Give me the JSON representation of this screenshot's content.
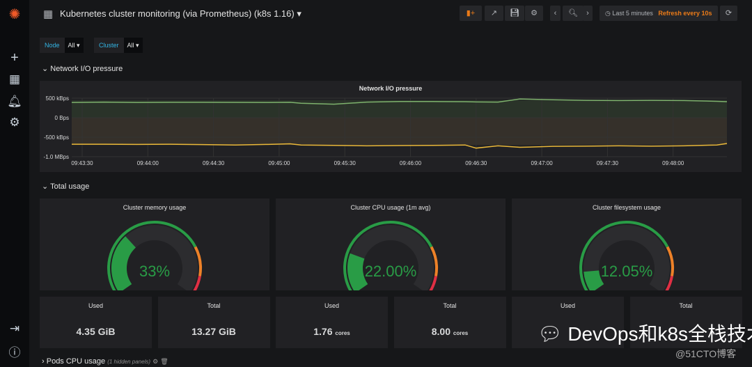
{
  "header": {
    "title": "Kubernetes cluster monitoring (via Prometheus) (k8s 1.16)",
    "time_range": "Last 5 minutes",
    "refresh": "Refresh every 10s"
  },
  "variables": [
    {
      "label": "Node",
      "value": "All"
    },
    {
      "label": "Cluster",
      "value": "All"
    }
  ],
  "rows": {
    "network": "Network I/O pressure",
    "total": "Total usage",
    "pods": "Pods CPU usage",
    "pods_hidden": "(1 hidden panels)"
  },
  "colors": {
    "accent": "#33b5e5",
    "refresh": "#eb7b18",
    "green": "#37872d",
    "ok": "#299c46",
    "warn": "#ed8128",
    "crit": "#e02f44",
    "in": "#7eb26d",
    "out": "#eab839"
  },
  "chart_data": {
    "type": "line",
    "title": "Network I/O pressure",
    "yticks": [
      "500 kBps",
      "0 Bps",
      "-500 kBps",
      "-1.0 MBps"
    ],
    "ylim": [
      -1000,
      500
    ],
    "yunit": "kBps",
    "xticks": [
      "09:43:30",
      "09:44:00",
      "09:44:30",
      "09:45:00",
      "09:45:30",
      "09:46:00",
      "09:46:30",
      "09:47:00",
      "09:47:30",
      "09:48:00"
    ],
    "x_seconds_from_first_tick": [
      -5,
      10,
      25,
      40,
      55,
      70,
      85,
      95,
      100,
      115,
      130,
      145,
      160,
      175,
      180,
      190,
      200,
      215,
      230,
      245,
      260,
      275,
      290,
      296
    ],
    "series": [
      {
        "values": [
          390,
          400,
          390,
          395,
          395,
          392,
          390,
          395,
          370,
          345,
          400,
          415,
          415,
          410,
          405,
          400,
          480,
          460,
          445,
          440,
          445,
          440,
          420,
          410
        ],
        "color": "#7eb26d"
      },
      {
        "values": [
          -680,
          -680,
          -685,
          -680,
          -690,
          -700,
          -685,
          -670,
          -700,
          -710,
          -720,
          -715,
          -710,
          -700,
          -780,
          -720,
          -760,
          -735,
          -730,
          -720,
          -730,
          -720,
          -700,
          -660
        ],
        "color": "#eab839"
      }
    ]
  },
  "gauges": [
    {
      "title": "Cluster memory usage",
      "value": 33,
      "label": "33%"
    },
    {
      "title": "Cluster CPU usage (1m avg)",
      "value": 22,
      "label": "22.00%"
    },
    {
      "title": "Cluster filesystem usage",
      "value": 12.05,
      "label": "12.05%"
    }
  ],
  "stats": [
    {
      "title": "Used",
      "value": "4.35 GiB",
      "unit": ""
    },
    {
      "title": "Total",
      "value": "13.27 GiB",
      "unit": ""
    },
    {
      "title": "Used",
      "value": "1.76",
      "unit": "cores"
    },
    {
      "title": "Total",
      "value": "8.00",
      "unit": "cores"
    },
    {
      "title": "Used",
      "value": "",
      "unit": ""
    },
    {
      "title": "Total",
      "value": "",
      "unit": ""
    }
  ],
  "watermark": {
    "text": "DevOps和k8s全栈技术",
    "source": "@51CTO博客"
  }
}
